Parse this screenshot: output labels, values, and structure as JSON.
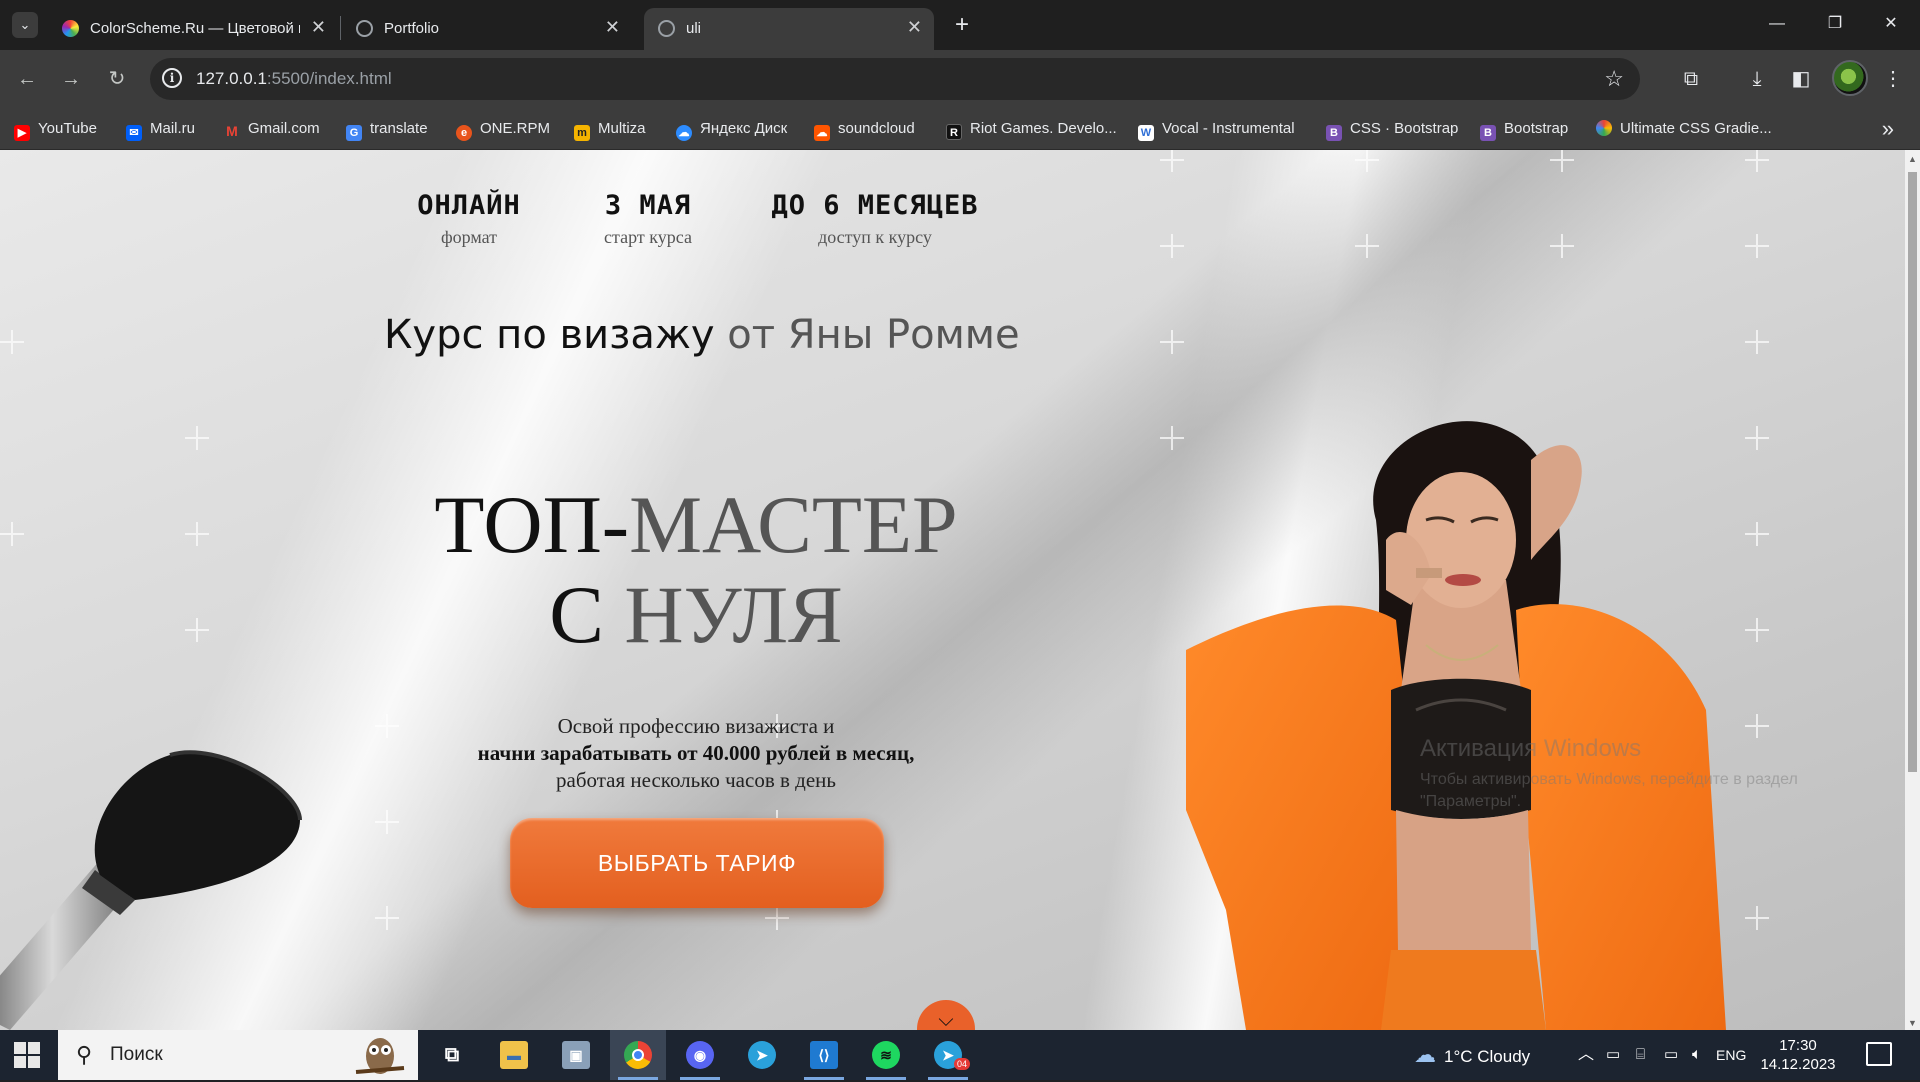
{
  "browser": {
    "tabs": [
      {
        "title": "ColorScheme.Ru — Цветовой к",
        "favicon": "colorwheel-icon",
        "active": false
      },
      {
        "title": "Portfolio",
        "favicon": "globe-icon",
        "active": false
      },
      {
        "title": "uli",
        "favicon": "globe-icon",
        "active": true
      }
    ],
    "url_host": "127.0.0.1",
    "url_path": ":5500/index.html",
    "bookmarks": [
      {
        "label": "YouTube",
        "icon": "youtube-icon",
        "color": "#ff0000"
      },
      {
        "label": "Mail.ru",
        "icon": "mailru-icon",
        "color": "#005ff9"
      },
      {
        "label": "Gmail.com",
        "icon": "gmail-icon",
        "color": "#ea4335"
      },
      {
        "label": "translate",
        "icon": "translate-icon",
        "color": "#4285f4"
      },
      {
        "label": "ONE.RPM",
        "icon": "onerpm-icon",
        "color": "#e8541c"
      },
      {
        "label": "Multiza",
        "icon": "multiza-icon",
        "color": "#f5b400"
      },
      {
        "label": "Яндекс Диск",
        "icon": "yandex-disk-icon",
        "color": "#2d8cff"
      },
      {
        "label": "soundcloud",
        "icon": "soundcloud-icon",
        "color": "#ff5500"
      },
      {
        "label": "Riot Games. Develo...",
        "icon": "riot-icon",
        "color": "#111111"
      },
      {
        "label": "Vocal - Instrumental",
        "icon": "vocal-icon",
        "color": "#2f6fd6"
      },
      {
        "label": "CSS · Bootstrap",
        "icon": "bootstrap-icon",
        "color": "#7952b3"
      },
      {
        "label": "Bootstrap",
        "icon": "bootstrap-icon",
        "color": "#7952b3"
      },
      {
        "label": "Ultimate CSS Gradie...",
        "icon": "gradient-icon",
        "color": "#34a853"
      }
    ]
  },
  "page": {
    "facts": [
      {
        "title": "ОНЛАЙН",
        "subtitle": "формат"
      },
      {
        "title": "3 МАЯ",
        "subtitle": "старт курса"
      },
      {
        "title": "ДО 6 МЕСЯЦЕВ",
        "subtitle": "доступ к курсу"
      }
    ],
    "course_title_dark": "Курс по визажу",
    "course_title_grey": "от Яны Ромме",
    "headline_1_dark": "ТОП-",
    "headline_1_grey": "МАСТЕР",
    "headline_2_dark": "С ",
    "headline_2_grey": "НУЛЯ",
    "desc_line1": "Освой профессию визажиста и",
    "desc_line2": "начни зарабатывать от 40.000 рублей в месяц,",
    "desc_line3": "работая несколько часов в день",
    "cta_label": "ВЫБРАТЬ ТАРИФ",
    "accent_color": "#e9612a"
  },
  "windows_watermark": {
    "title": "Активация Windows",
    "text": "Чтобы активировать Windows, перейдите в раздел \"Параметры\"."
  },
  "taskbar": {
    "search_placeholder": "Поиск",
    "apps": [
      {
        "name": "task-view-icon"
      },
      {
        "name": "file-explorer-icon"
      },
      {
        "name": "photos-icon"
      },
      {
        "name": "chrome-icon"
      },
      {
        "name": "discord-icon"
      },
      {
        "name": "telegram-icon"
      },
      {
        "name": "vscode-icon"
      },
      {
        "name": "spotify-icon"
      },
      {
        "name": "telegram-icon",
        "badge": "04"
      }
    ],
    "weather": "1°C  Cloudy",
    "language": "ENG",
    "time": "17:30",
    "date": "14.12.2023"
  }
}
